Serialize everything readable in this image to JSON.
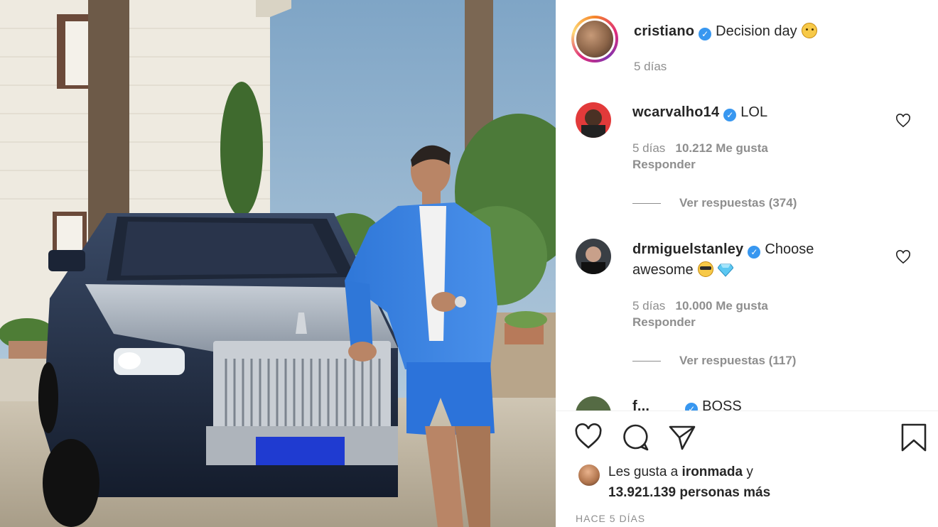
{
  "post": {
    "author": "cristiano",
    "caption": "Decision day",
    "age": "5 días"
  },
  "comments": [
    {
      "username": "wcarvalho14",
      "text": "LOL",
      "age": "5 días",
      "likes": "10.212 Me gusta",
      "reply": "Responder",
      "view_replies": "Ver respuestas (374)"
    },
    {
      "username": "drmiguelstanley",
      "text_line1": "Choose",
      "text_line2": "awesome",
      "age": "5 días",
      "likes": "10.000 Me gusta",
      "reply": "Responder",
      "view_replies": "Ver respuestas (117)"
    },
    {
      "username": "f...",
      "text": "BOSS"
    }
  ],
  "likes": {
    "prefix": "Les gusta a",
    "liker": "ironmada",
    "suffix": "y",
    "count_line": "13.921.139 personas más"
  },
  "timestamp": "HACE 5 DÍAS",
  "icons": {
    "like": "heart-outline-icon",
    "comment": "comment-bubble-icon",
    "share": "paper-plane-icon",
    "save": "bookmark-icon",
    "verified": "verified-badge-icon"
  },
  "colors": {
    "verified": "#3897f0",
    "text": "#262626",
    "secondary": "#8e8e8e"
  }
}
